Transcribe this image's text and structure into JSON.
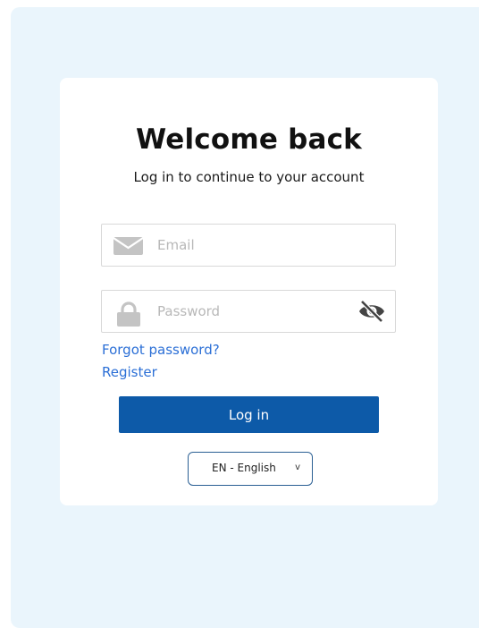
{
  "login": {
    "title": "Welcome back",
    "subtitle": "Log in to continue to your account",
    "email": {
      "placeholder": "Email",
      "value": "",
      "icon": "mail-icon"
    },
    "password": {
      "placeholder": "Password",
      "value": "",
      "icon": "lock-icon",
      "toggle_icon": "eye-slash-icon"
    },
    "forgot_password_label": "Forgot password?",
    "register_label": "Register",
    "login_button_label": "Log in",
    "language": {
      "selected": "EN - English",
      "chevron": "v"
    }
  },
  "colors": {
    "background_panel": "#eaf5fc",
    "card": "#ffffff",
    "primary_button": "#0d5aa8",
    "link": "#2b6fd6",
    "select_border": "#2a5f93",
    "input_border": "#d8d8d8",
    "icon_gray": "#c4c4c4"
  }
}
